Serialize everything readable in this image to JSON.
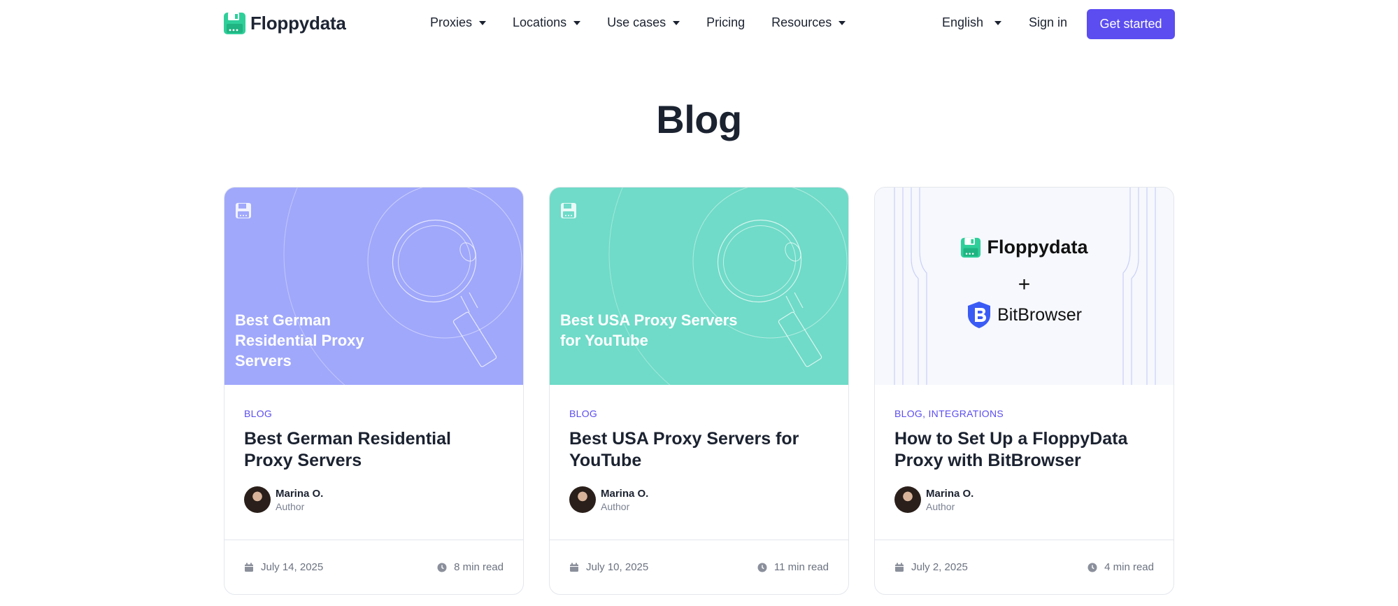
{
  "brand": {
    "name": "Floppydata",
    "accent": "#5b4df0",
    "logo_color": "#2fcf9a"
  },
  "nav": {
    "items": [
      {
        "label": "Proxies",
        "has_dropdown": true
      },
      {
        "label": "Locations",
        "has_dropdown": true
      },
      {
        "label": "Use cases",
        "has_dropdown": true
      },
      {
        "label": "Pricing",
        "has_dropdown": false
      },
      {
        "label": "Resources",
        "has_dropdown": true
      }
    ],
    "language": "English",
    "sign_in": "Sign in",
    "cta": "Get started"
  },
  "page": {
    "title": "Blog"
  },
  "cards": [
    {
      "image_title": "Best German Residential Proxy Servers",
      "image_bg": "#a0a8fb",
      "category": "BLOG",
      "title": "Best German Residential Proxy Servers",
      "author_name": "Marina O.",
      "author_role": "Author",
      "date": "July 14, 2025",
      "read_time": "8 min read"
    },
    {
      "image_title": "Best USA Proxy Servers for YouTube",
      "image_bg": "#6fdbc8",
      "category": "BLOG",
      "title": "Best USA Proxy Servers for YouTube",
      "author_name": "Marina O.",
      "author_role": "Author",
      "date": "July 10, 2025",
      "read_time": "11 min read"
    },
    {
      "image_partner_a": "Floppydata",
      "image_plus": "+",
      "image_partner_b": "BitBrowser",
      "image_bg": "#f6f8fd",
      "category": "BLOG, INTEGRATIONS",
      "title": "How to Set Up a FloppyData Proxy with BitBrowser",
      "author_name": "Marina O.",
      "author_role": "Author",
      "date": "July 2, 2025",
      "read_time": "4 min read"
    }
  ],
  "icons": {
    "logo": "floppy-disk-icon",
    "date": "calendar-icon",
    "read_time": "clock-icon",
    "dropdown": "caret-down-icon",
    "bitbrowser": "bitbrowser-shield-icon"
  }
}
